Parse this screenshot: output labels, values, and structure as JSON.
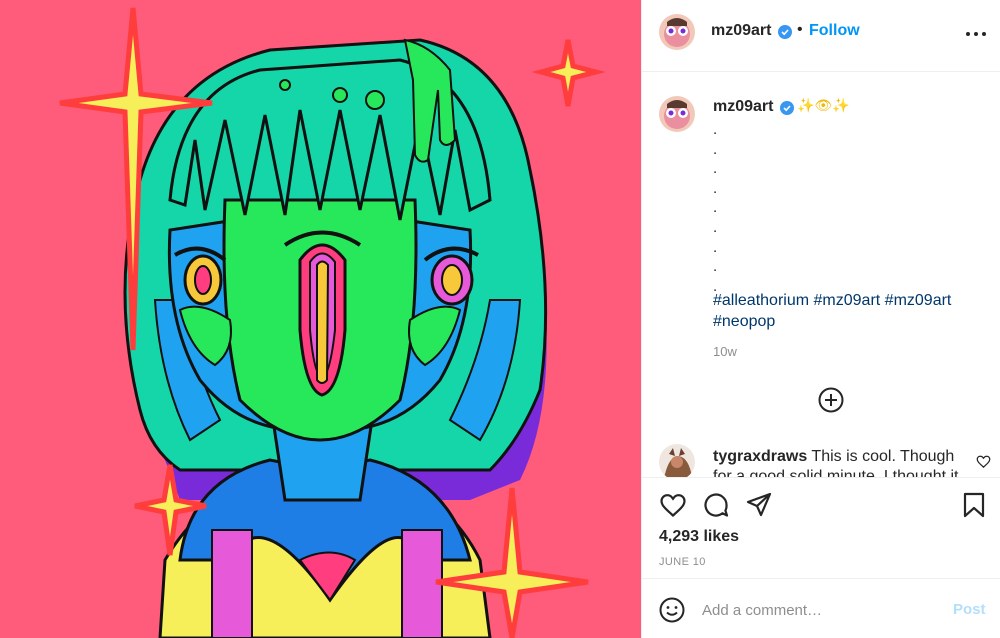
{
  "post": {
    "artwork": "colorful neo-pop illustration of a girl with green hair and a third eye"
  },
  "header": {
    "username": "mz09art",
    "verified": true,
    "separator": "•",
    "follow_label": "Follow",
    "more_icon": "more-horizontal-icon"
  },
  "caption": {
    "username": "mz09art",
    "emoji": "✨👁✨",
    "dots": ".\n.\n.\n.\n.\n.\n.\n.\n.",
    "hashtags": [
      "#alleathorium",
      "#mz09art",
      "#mz09art",
      "#neopop"
    ],
    "age": "10w"
  },
  "load_more_icon": "plus-circle-icon",
  "comments": [
    {
      "username": "tygraxdraws",
      "text": "This is cool. Though",
      "text_more": "for a good solid minute, I thought it"
    }
  ],
  "actions": {
    "like_icon": "heart-icon",
    "comment_icon": "comment-icon",
    "share_icon": "send-icon",
    "save_icon": "bookmark-icon",
    "likes": "4,293 likes",
    "date": "JUNE 10"
  },
  "add_comment": {
    "placeholder": "Add a comment…",
    "post_label": "Post"
  },
  "colors": {
    "art_bg": "#ff5c7c",
    "link": "#0095f6",
    "hashtag": "#00376b",
    "post_disabled": "#b2dffc"
  }
}
